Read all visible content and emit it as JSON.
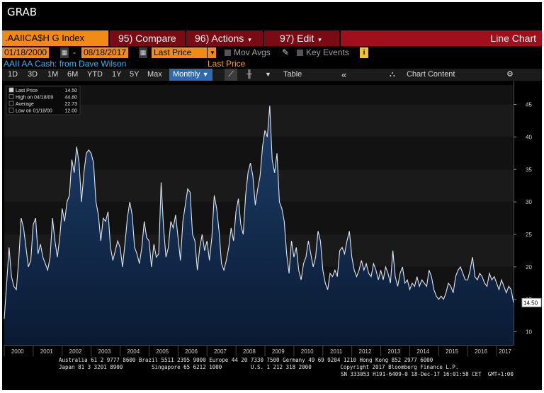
{
  "window": {
    "title": "GRAB"
  },
  "toolbar": {
    "ticker": ".AAIICA$H G Index",
    "compare": "95) Compare",
    "actions": "96) Actions",
    "edit": "97) Edit",
    "chart_type": "Line Chart",
    "caret": "▾"
  },
  "controls": {
    "start_date": "01/18/2000",
    "dash": "-",
    "end_date": "08/18/2017",
    "field": "Last Price",
    "mov_avgs": "Mov Avgs",
    "key_events": "Key Events",
    "periods": [
      "1D",
      "3D",
      "1M",
      "6M",
      "YTD",
      "1Y",
      "5Y",
      "Max"
    ],
    "frequency": "Monthly",
    "table": "Table",
    "chart_content": "Chart Content"
  },
  "security_label": "AAII AA Cash: from Dave Wilson",
  "series_label": "Last Price",
  "legend": [
    {
      "label": "Last Price",
      "value": "14.50"
    },
    {
      "label": "High on 04/18/09",
      "value": "44.80"
    },
    {
      "label": "Average",
      "value": "22.73"
    },
    {
      "label": "Low on 01/18/00",
      "value": "12.00"
    }
  ],
  "footer": {
    "line1": "Australia 61 2 9777 8600 Brazil 5511 2395 9000 Europe 44 20 7330 7500 Germany 49 69 9204 1210 Hong Kong 852 2977 6000",
    "line2": "Japan 81 3 3201 8900         Singapore 65 6212 1000         U.S. 1 212 318 2000         Copyright 2017 Bloomberg Finance L.P.",
    "line3": "SN 333053 H191-6409-0 18-Dec-17 16:01:58 CET  GMT+1:00"
  },
  "colors": {
    "background": "#000000",
    "line": "#dfe6ee",
    "fill_top": "#1d3f6a",
    "fill_bottom": "#0a1a33",
    "axis_text": "#d0d0d0",
    "ticker_bg": "#f28b16",
    "menu_bg": "#7a0a14"
  },
  "chart_data": {
    "type": "area",
    "title": "",
    "xlabel": "",
    "ylabel": "",
    "y_ticks": [
      10,
      15,
      20,
      25,
      30,
      35,
      40,
      45
    ],
    "ylim": [
      8,
      48
    ],
    "last_value_label": "14.50",
    "x_tick_labels": [
      "2000",
      "2001",
      "2002",
      "2003",
      "2004",
      "2005",
      "2006",
      "2007",
      "2008",
      "2009",
      "2010",
      "2011",
      "2012",
      "2013",
      "2014",
      "2015",
      "2016",
      "2017"
    ],
    "grid": "horizontal bands",
    "series": [
      {
        "name": "Last Price",
        "x": [
          "2000-01",
          "2000-02",
          "2000-03",
          "2000-04",
          "2000-05",
          "2000-06",
          "2000-07",
          "2000-08",
          "2000-09",
          "2000-10",
          "2000-11",
          "2000-12",
          "2001-01",
          "2001-02",
          "2001-03",
          "2001-04",
          "2001-05",
          "2001-06",
          "2001-07",
          "2001-08",
          "2001-09",
          "2001-10",
          "2001-11",
          "2001-12",
          "2002-01",
          "2002-02",
          "2002-03",
          "2002-04",
          "2002-05",
          "2002-06",
          "2002-07",
          "2002-08",
          "2002-09",
          "2002-10",
          "2002-11",
          "2002-12",
          "2003-01",
          "2003-02",
          "2003-03",
          "2003-04",
          "2003-05",
          "2003-06",
          "2003-07",
          "2003-08",
          "2003-09",
          "2003-10",
          "2003-11",
          "2003-12",
          "2004-01",
          "2004-02",
          "2004-03",
          "2004-04",
          "2004-05",
          "2004-06",
          "2004-07",
          "2004-08",
          "2004-09",
          "2004-10",
          "2004-11",
          "2004-12",
          "2005-01",
          "2005-02",
          "2005-03",
          "2005-04",
          "2005-05",
          "2005-06",
          "2005-07",
          "2005-08",
          "2005-09",
          "2005-10",
          "2005-11",
          "2005-12",
          "2006-01",
          "2006-02",
          "2006-03",
          "2006-04",
          "2006-05",
          "2006-06",
          "2006-07",
          "2006-08",
          "2006-09",
          "2006-10",
          "2006-11",
          "2006-12",
          "2007-01",
          "2007-02",
          "2007-03",
          "2007-04",
          "2007-05",
          "2007-06",
          "2007-07",
          "2007-08",
          "2007-09",
          "2007-10",
          "2007-11",
          "2007-12",
          "2008-01",
          "2008-02",
          "2008-03",
          "2008-04",
          "2008-05",
          "2008-06",
          "2008-07",
          "2008-08",
          "2008-09",
          "2008-10",
          "2008-11",
          "2008-12",
          "2009-01",
          "2009-02",
          "2009-03",
          "2009-04",
          "2009-05",
          "2009-06",
          "2009-07",
          "2009-08",
          "2009-09",
          "2009-10",
          "2009-11",
          "2009-12",
          "2010-01",
          "2010-02",
          "2010-03",
          "2010-04",
          "2010-05",
          "2010-06",
          "2010-07",
          "2010-08",
          "2010-09",
          "2010-10",
          "2010-11",
          "2010-12",
          "2011-01",
          "2011-02",
          "2011-03",
          "2011-04",
          "2011-05",
          "2011-06",
          "2011-07",
          "2011-08",
          "2011-09",
          "2011-10",
          "2011-11",
          "2011-12",
          "2012-01",
          "2012-02",
          "2012-03",
          "2012-04",
          "2012-05",
          "2012-06",
          "2012-07",
          "2012-08",
          "2012-09",
          "2012-10",
          "2012-11",
          "2012-12",
          "2013-01",
          "2013-02",
          "2013-03",
          "2013-04",
          "2013-05",
          "2013-06",
          "2013-07",
          "2013-08",
          "2013-09",
          "2013-10",
          "2013-11",
          "2013-12",
          "2014-01",
          "2014-02",
          "2014-03",
          "2014-04",
          "2014-05",
          "2014-06",
          "2014-07",
          "2014-08",
          "2014-09",
          "2014-10",
          "2014-11",
          "2014-12",
          "2015-01",
          "2015-02",
          "2015-03",
          "2015-04",
          "2015-05",
          "2015-06",
          "2015-07",
          "2015-08",
          "2015-09",
          "2015-10",
          "2015-11",
          "2015-12",
          "2016-01",
          "2016-02",
          "2016-03",
          "2016-04",
          "2016-05",
          "2016-06",
          "2016-07",
          "2016-08",
          "2016-09",
          "2016-10",
          "2016-11",
          "2016-12",
          "2017-01",
          "2017-02",
          "2017-03",
          "2017-04",
          "2017-05",
          "2017-06",
          "2017-07",
          "2017-08"
        ],
        "values": [
          12.0,
          17.5,
          23.0,
          18.5,
          17.0,
          16.5,
          21.0,
          27.5,
          26.0,
          23.0,
          20.0,
          21.0,
          26.5,
          27.5,
          22.0,
          23.5,
          21.5,
          20.5,
          19.5,
          21.5,
          27.5,
          24.0,
          21.5,
          24.5,
          29.0,
          27.0,
          30.0,
          31.0,
          36.5,
          34.5,
          38.5,
          36.0,
          30.0,
          34.5,
          37.5,
          38.0,
          37.5,
          36.0,
          30.0,
          28.0,
          24.0,
          27.5,
          27.0,
          28.5,
          23.0,
          21.0,
          22.5,
          24.0,
          23.0,
          20.0,
          23.5,
          27.5,
          30.0,
          28.0,
          23.0,
          22.0,
          20.5,
          23.0,
          27.0,
          24.5,
          24.0,
          20.0,
          23.5,
          21.5,
          22.0,
          33.0,
          26.0,
          21.5,
          23.0,
          27.0,
          26.0,
          28.0,
          24.5,
          21.0,
          27.0,
          29.5,
          32.0,
          31.5,
          25.0,
          24.0,
          19.5,
          23.0,
          25.0,
          22.5,
          24.0,
          21.0,
          24.5,
          31.0,
          29.0,
          25.5,
          20.5,
          19.5,
          21.0,
          23.0,
          26.0,
          24.0,
          28.5,
          30.5,
          26.5,
          25.0,
          31.0,
          34.5,
          36.0,
          34.0,
          29.5,
          32.0,
          34.0,
          38.5,
          41.0,
          40.0,
          44.8,
          36.5,
          34.5,
          37.5,
          30.0,
          29.0,
          27.0,
          22.0,
          19.0,
          24.0,
          21.5,
          23.0,
          19.5,
          18.0,
          20.5,
          21.5,
          24.0,
          22.0,
          20.0,
          21.5,
          25.5,
          24.0,
          19.5,
          17.5,
          16.5,
          19.0,
          18.5,
          19.5,
          18.5,
          22.5,
          23.0,
          22.0,
          24.0,
          25.5,
          21.5,
          19.5,
          18.5,
          19.5,
          21.0,
          19.5,
          20.5,
          19.0,
          18.5,
          20.5,
          19.5,
          18.0,
          19.5,
          18.0,
          20.0,
          19.0,
          17.5,
          22.5,
          18.5,
          17.0,
          19.0,
          20.0,
          17.5,
          18.0,
          16.5,
          17.5,
          17.0,
          18.5,
          17.0,
          18.0,
          17.5,
          17.0,
          19.5,
          18.5,
          16.5,
          15.5,
          15.0,
          15.5,
          15.0,
          16.0,
          17.5,
          17.0,
          16.0,
          18.5,
          19.5,
          20.0,
          19.0,
          18.0,
          18.0,
          19.5,
          21.5,
          18.5,
          18.0,
          19.0,
          18.5,
          17.5,
          17.0,
          19.0,
          18.0,
          18.5,
          17.5,
          16.5,
          18.0,
          17.0,
          16.0,
          17.0,
          16.5,
          14.5
        ]
      }
    ]
  }
}
